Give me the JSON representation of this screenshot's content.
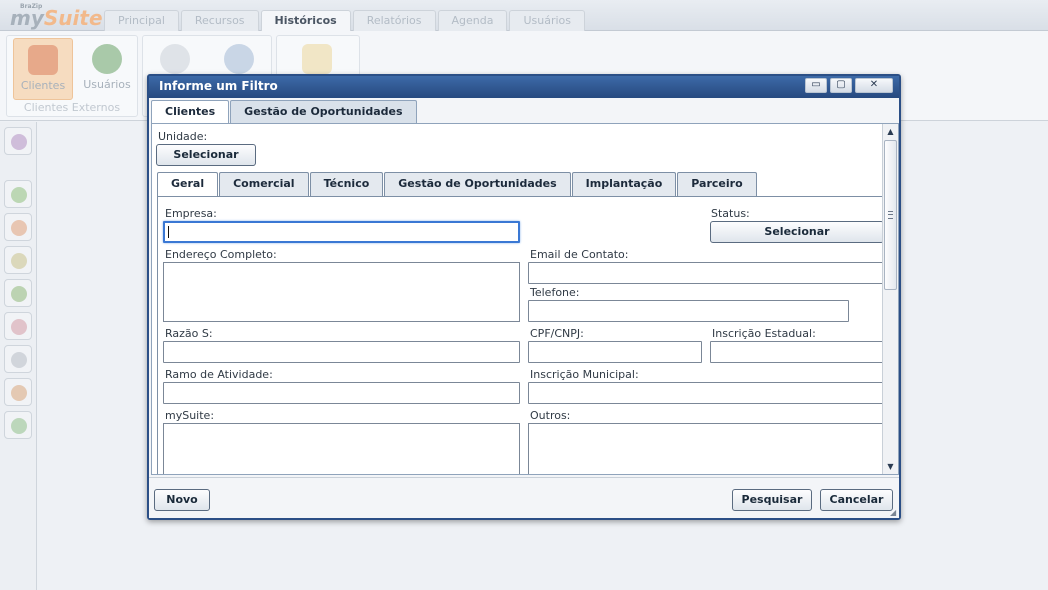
{
  "app": {
    "brand_small": "BraZip",
    "brand_prefix": "my",
    "brand_suffix": "Suite",
    "menu_tabs": [
      "Principal",
      "Recursos",
      "Históricos",
      "Relatórios",
      "Agenda",
      "Usuários"
    ],
    "active_menu_tab": "Históricos",
    "ribbon": {
      "buttons": [
        "Clientes",
        "Usuários"
      ],
      "group_label": "Clientes Externos"
    },
    "colors": {
      "accent": "#2b4f86",
      "focus": "#3a78d4",
      "ribbon_selected": "#f6dcc0"
    }
  },
  "dialog": {
    "title": "Informe um Filtro",
    "window_buttons": {
      "minimize": "▭",
      "maximize": "▢",
      "close": "✕"
    },
    "outer_tabs": [
      "Clientes",
      "Gestão de Oportunidades"
    ],
    "unidade_label": "Unidade:",
    "unidade_button": "Selecionar",
    "inner_tabs": [
      "Geral",
      "Comercial",
      "Técnico",
      "Gestão de Oportunidades",
      "Implantação",
      "Parceiro"
    ],
    "form": {
      "empresa_label": "Empresa:",
      "empresa_value": "",
      "status_label": "Status:",
      "status_button": "Selecionar",
      "endereco_label": "Endereço Completo:",
      "email_label": "Email de Contato:",
      "telefone_label": "Telefone:",
      "razao_label": "Razão S:",
      "cpf_label": "CPF/CNPJ:",
      "ie_label": "Inscrição Estadual:",
      "ramo_label": "Ramo de Atividade:",
      "im_label": "Inscrição Municipal:",
      "mysuite_label": "mySuite:",
      "outros_label": "Outros:"
    },
    "footer": {
      "novo": "Novo",
      "pesquisar": "Pesquisar",
      "cancelar": "Cancelar"
    },
    "scroll_arrows": {
      "up": "▲",
      "down": "▼"
    }
  }
}
